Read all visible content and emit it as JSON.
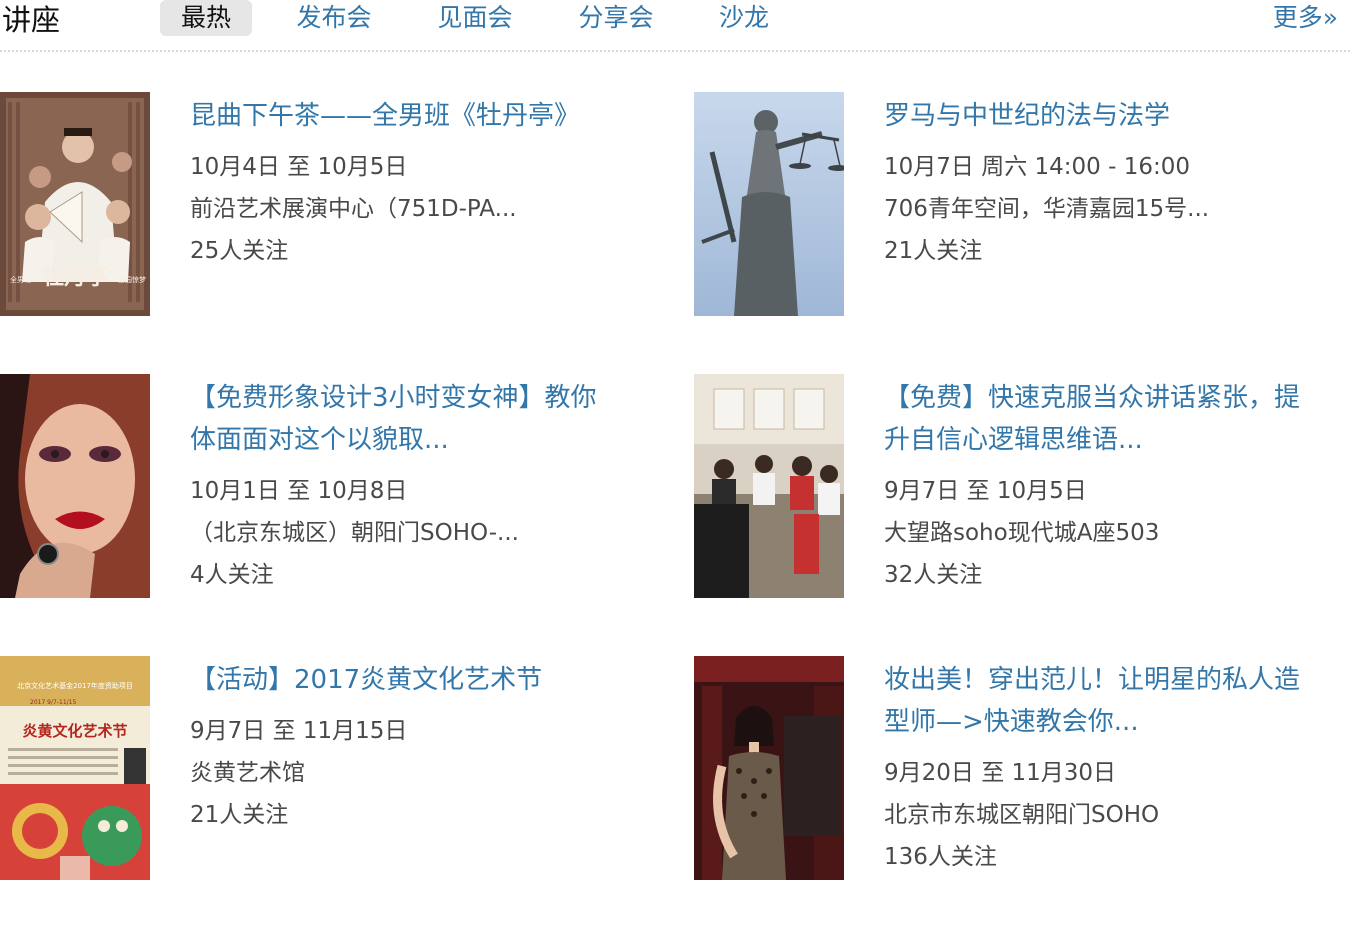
{
  "header": {
    "title": "讲座",
    "tabs": [
      "最热",
      "发布会",
      "见面会",
      "分享会",
      "沙龙"
    ],
    "more": "更多»"
  },
  "colors": {
    "link": "#3377aa",
    "text": "#494949",
    "active_tab_bg": "#e6e6e6"
  },
  "events": [
    {
      "title": "昆曲下午茶——全男班《牡丹亭》",
      "date": "10月4日 至 10月5日",
      "location": "前沿艺术展演中心（751D-PA...",
      "followers": "25人关注",
      "poster": {
        "text": "牡丹亭",
        "caption_left": "全男班",
        "caption_right": "游园惊梦",
        "icon": "opera-poster"
      }
    },
    {
      "title": "罗马与中世纪的法与法学",
      "date": "10月7日 周六  14:00 - 16:00",
      "location": "706青年空间，华清嘉园15号...",
      "followers": "21人关注",
      "poster": {
        "icon": "justice-statue-photo"
      }
    },
    {
      "title": "【免费形象设计3小时变女神】教你体面面对这个以貌取...",
      "date": "10月1日 至 10月8日",
      "location": "（北京东城区）朝阳门SOHO-...",
      "followers": "4人关注",
      "poster": {
        "icon": "makeup-portrait-photo"
      }
    },
    {
      "title": "【免费】快速克服当众讲话紧张，提升自信心逻辑思维语...",
      "date": "9月7日 至 10月5日",
      "location": "大望路soho现代城A座503",
      "followers": "32人关注",
      "poster": {
        "icon": "classroom-photo"
      }
    },
    {
      "title": "【活动】2017炎黄文化艺术节",
      "date": "9月7日 至 11月15日",
      "location": "炎黄艺术馆",
      "followers": "21人关注",
      "poster": {
        "top_text": "北京文化艺术基金2017年度资助项目",
        "date_text": "2017 9/7-11/15",
        "headline": "炎黄文化艺术节",
        "icon": "festival-poster"
      }
    },
    {
      "title": "妆出美！穿出范儿！让明星的私人造型师—>快速教会你...",
      "date": "9月20日 至 11月30日",
      "location": "北京市东城区朝阳门SOHO",
      "followers": "136人关注",
      "poster": {
        "icon": "fashion-portrait-photo"
      }
    }
  ]
}
